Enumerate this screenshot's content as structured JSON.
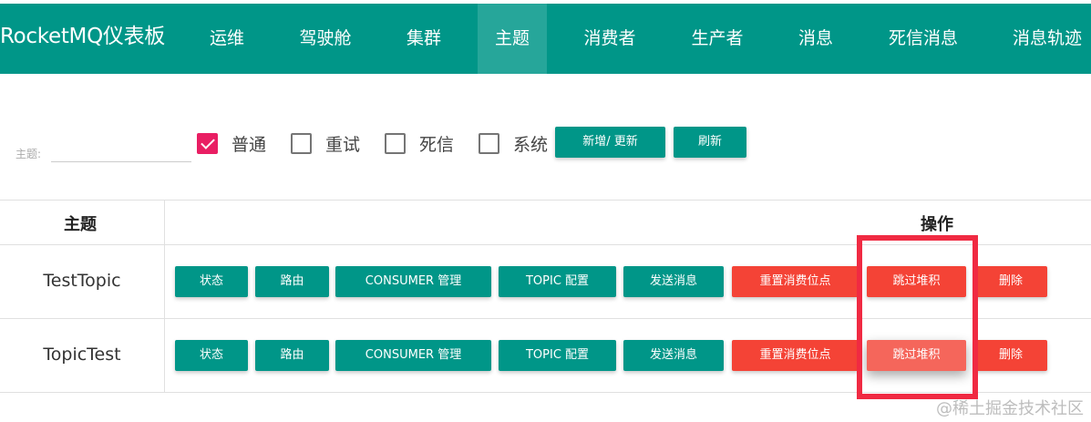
{
  "app": {
    "brand": "RocketMQ仪表板"
  },
  "nav": [
    {
      "label": "运维",
      "active": false
    },
    {
      "label": "驾驶舱",
      "active": false
    },
    {
      "label": "集群",
      "active": false
    },
    {
      "label": "主题",
      "active": true
    },
    {
      "label": "消费者",
      "active": false
    },
    {
      "label": "生产者",
      "active": false
    },
    {
      "label": "消息",
      "active": false
    },
    {
      "label": "死信消息",
      "active": false
    },
    {
      "label": "消息轨迹",
      "active": false
    }
  ],
  "filter": {
    "label": "主题:",
    "value": "",
    "checkboxes": [
      {
        "label": "普通",
        "checked": true
      },
      {
        "label": "重试",
        "checked": false
      },
      {
        "label": "死信",
        "checked": false
      },
      {
        "label": "系统",
        "checked": false
      }
    ],
    "add_update_label": "新增/ 更新",
    "refresh_label": "刷新"
  },
  "table": {
    "headers": {
      "topic": "主题",
      "actions": "操作"
    },
    "action_labels": {
      "status": "状态",
      "route": "路由",
      "consumer": "CONSUMER 管理",
      "topic_config": "TOPIC 配置",
      "send": "发送消息",
      "reset_offset": "重置消费位点",
      "skip_backlog": "跳过堆积",
      "delete": "删除"
    },
    "rows": [
      {
        "topic": "TestTopic"
      },
      {
        "topic": "TopicTest"
      }
    ]
  },
  "colors": {
    "primary": "#009688",
    "danger": "#f44336",
    "checkbox_checked": "#e91e63",
    "highlight_box": "#f02a42"
  },
  "watermark": "@稀土掘金技术社区"
}
